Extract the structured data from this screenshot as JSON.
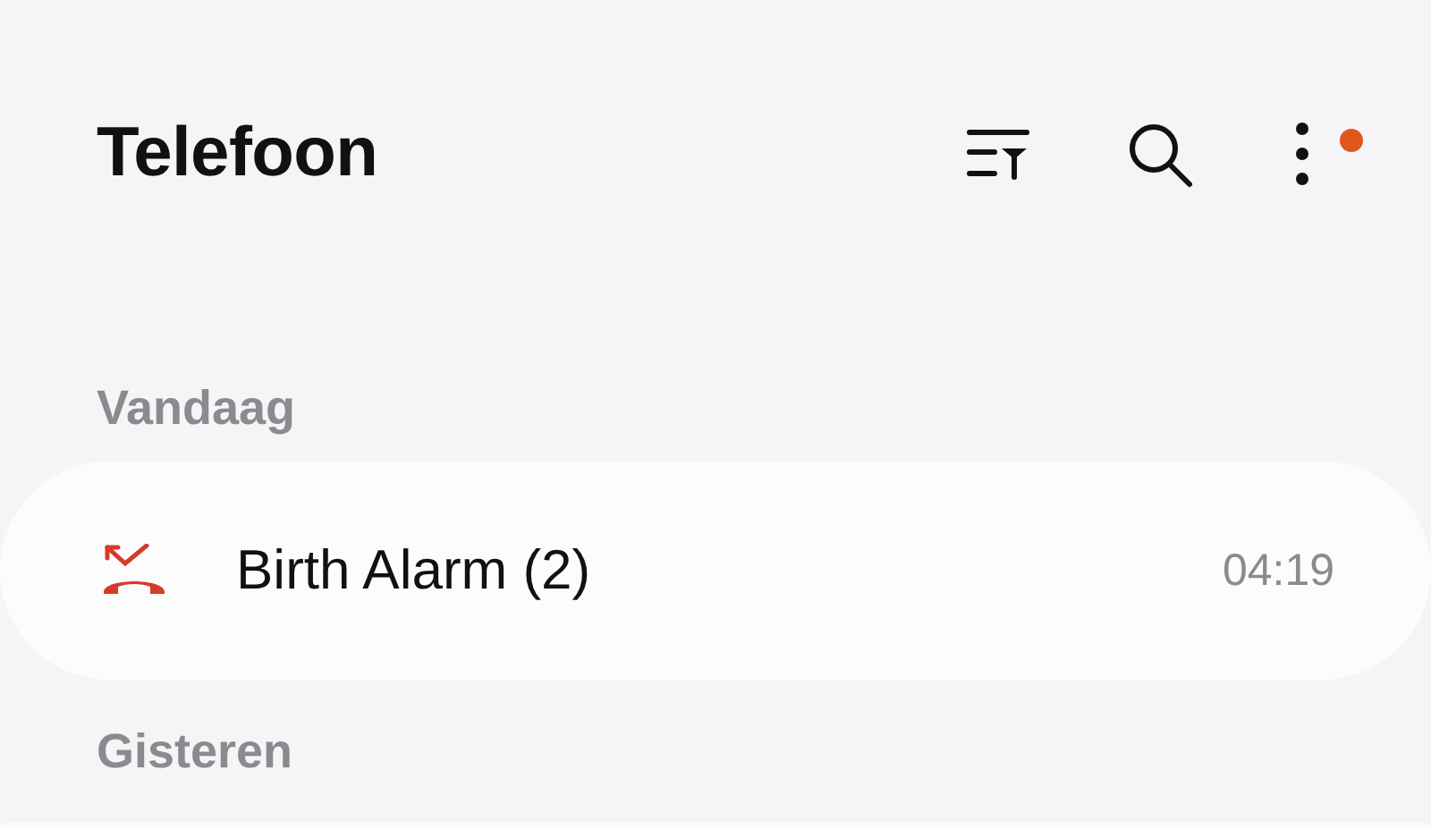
{
  "header": {
    "title": "Telefoon",
    "menu_badge": true
  },
  "sections": [
    {
      "title": "Vandaag",
      "calls": [
        {
          "kind": "missed",
          "name": "Birth Alarm (2)",
          "time": "04:19"
        }
      ]
    },
    {
      "title": "Gisteren",
      "more_below": true
    }
  ]
}
